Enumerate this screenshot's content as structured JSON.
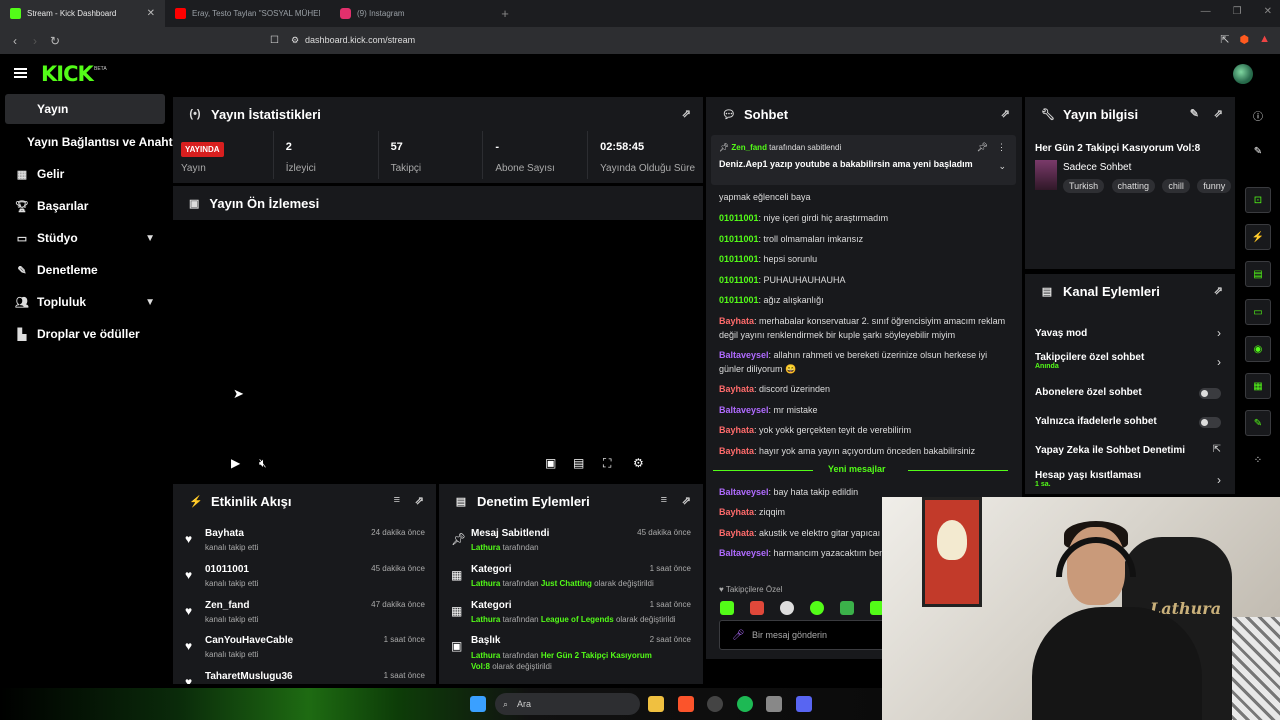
{
  "browser": {
    "tabs": [
      {
        "title": "Stream - Kick Dashboard",
        "color": "#53fc18"
      },
      {
        "title": "Eray, Testo Taylan \"SOSYAL MÜHEND",
        "color": "#ff0000"
      },
      {
        "title": "(9) Instagram",
        "color": "#e1306c"
      }
    ],
    "url": "dashboard.kick.com/stream"
  },
  "header": {
    "logo": "KICK",
    "beta": "BETA"
  },
  "sidebar": {
    "items": [
      {
        "label": "Yayın",
        "icon": "broadcast-icon"
      },
      {
        "label": "Yayın Bağlantısı ve Anahtarı"
      },
      {
        "label": "Gelir",
        "icon": "revenue-icon"
      },
      {
        "label": "Başarılar",
        "icon": "trophy-icon"
      },
      {
        "label": "Stüdyo",
        "icon": "studio-icon"
      },
      {
        "label": "Denetleme",
        "icon": "wrench-icon"
      },
      {
        "label": "Topluluk",
        "icon": "community-icon"
      },
      {
        "label": "Droplar ve ödüller",
        "icon": "drops-icon"
      }
    ]
  },
  "stats": {
    "title": "Yayın İstatistikleri",
    "live_badge": "YAYINDA",
    "items": [
      {
        "value": "",
        "label": "Yayın"
      },
      {
        "value": "2",
        "label": "İzleyici"
      },
      {
        "value": "57",
        "label": "Takipçi"
      },
      {
        "value": "-",
        "label": "Abone Sayısı"
      },
      {
        "value": "02:58:45",
        "label": "Yayında Olduğu Süre"
      }
    ]
  },
  "preview": {
    "title": "Yayın Ön İzlemesi"
  },
  "activity": {
    "title": "Etkinlik Akışı",
    "items": [
      {
        "name": "Bayhata",
        "sub": "kanalı takip etti",
        "time": "24 dakika önce"
      },
      {
        "name": "01011001",
        "sub": "kanalı takip etti",
        "time": "45 dakika önce"
      },
      {
        "name": "Zen_fand",
        "sub": "kanalı takip etti",
        "time": "47 dakika önce"
      },
      {
        "name": "CanYouHaveCable",
        "sub": "kanalı takip etti",
        "time": "1 saat önce"
      },
      {
        "name": "TaharetMuslugu36",
        "sub": "",
        "time": "1 saat önce"
      }
    ]
  },
  "moderation": {
    "title": "Denetim Eylemleri",
    "items": [
      {
        "name": "Mesaj Sabitlendi",
        "who": "Lathura",
        "mid": " tarafından",
        "target": "",
        "tail": "",
        "time": "45 dakika önce"
      },
      {
        "name": "Kategori",
        "who": "Lathura",
        "mid": " tarafından ",
        "target": "Just Chatting",
        "tail": " olarak değiştirildi",
        "time": "1 saat önce"
      },
      {
        "name": "Kategori",
        "who": "Lathura",
        "mid": " tarafından ",
        "target": "League of Legends",
        "tail": " olarak değiştirildi",
        "time": "1 saat önce"
      },
      {
        "name": "Başlık",
        "who": "Lathura",
        "mid": " tarafından ",
        "target": "Her Gün 2 Takipçi Kasıyorum Vol:8",
        "tail": " olarak değiştirildi",
        "time": "2 saat önce"
      }
    ]
  },
  "chat": {
    "title": "Sohbet",
    "pinned_user": "Zen_fand",
    "pinned_suffix": " tarafından sabitlendi",
    "pinned_text": "Deniz.Aep1 yazıp youtube a bakabilirsin ama yeni başladım",
    "messages": [
      {
        "user": "",
        "text": "yapmak eğlenceli baya"
      },
      {
        "user": "01011001",
        "text": ": niye içeri girdi hiç araştırmadım"
      },
      {
        "user": "01011001",
        "text": ": troll olmamaları imkansız"
      },
      {
        "user": "01011001",
        "text": ": hepsi sorunlu"
      },
      {
        "user": "01011001",
        "text": ": PUHAUHAUHAUHA"
      },
      {
        "user": "01011001",
        "text": ": ağız alışkanlığı"
      },
      {
        "user": "Bayhata",
        "text": ": merhabalar konservatuar 2. sınıf öğrencisiyim amacım reklam değil yayını renklendirmek bir kuple şarkı söyleyebilir miyim"
      },
      {
        "user": "Baltaveysel",
        "text": ": allahın rahmeti ve bereketi üzerinize olsun herkese iyi günler diliyorum 😄"
      },
      {
        "user": "Bayhata",
        "text": ": discord üzerinden"
      },
      {
        "user": "Baltaveysel",
        "text": ": mr mistake"
      },
      {
        "user": "Bayhata",
        "text": ": yok yokk gerçekten teyit de verebilirim"
      },
      {
        "user": "Bayhata",
        "text": ": hayır yok ama yayın açıyordum önceden bakabilirsiniz"
      }
    ],
    "divider": "Yeni mesajlar",
    "new_messages": [
      {
        "user": "Baltaveysel",
        "text": ": bay hata takip edildin"
      },
      {
        "user": "Bayhata",
        "text": ": ziqqim"
      },
      {
        "user": "Bayhata",
        "text": ": akustik ve elektro gitar yapıcaı"
      },
      {
        "user": "Baltaveysel",
        "text": ": harmancım yazacaktım ben yazamadım doğru tespit"
      }
    ],
    "followers_only": "Takipçilere Özel",
    "input_placeholder": "Bir mesaj gönderin"
  },
  "stream_info": {
    "title": "Yayın bilgisi",
    "stream_title": "Her Gün 2 Takipçi Kasıyorum Vol:8",
    "category": "Sadece Sohbet",
    "tags": [
      "Turkish",
      "chatting",
      "chill",
      "funny"
    ]
  },
  "channel_actions": {
    "title": "Kanal Eylemleri",
    "items": [
      {
        "label": "Yavaş mod",
        "sub": "",
        "kind": "arrow"
      },
      {
        "label": "Takipçilere özel sohbet",
        "sub": "Anında",
        "kind": "arrow"
      },
      {
        "label": "Abonelere özel sohbet",
        "sub": "",
        "kind": "toggle"
      },
      {
        "label": "Yalnızca ifadelerle sohbet",
        "sub": "",
        "kind": "toggle"
      },
      {
        "label": "Yapay Zeka ile Sohbet Denetimi",
        "sub": "",
        "kind": "link"
      },
      {
        "label": "Hesap yaşı kısıtlaması",
        "sub": "1 sa.",
        "kind": "arrow"
      }
    ]
  },
  "webcam": {
    "chair_brand": "Lathura"
  },
  "taskbar": {
    "search_placeholder": "Ara"
  }
}
